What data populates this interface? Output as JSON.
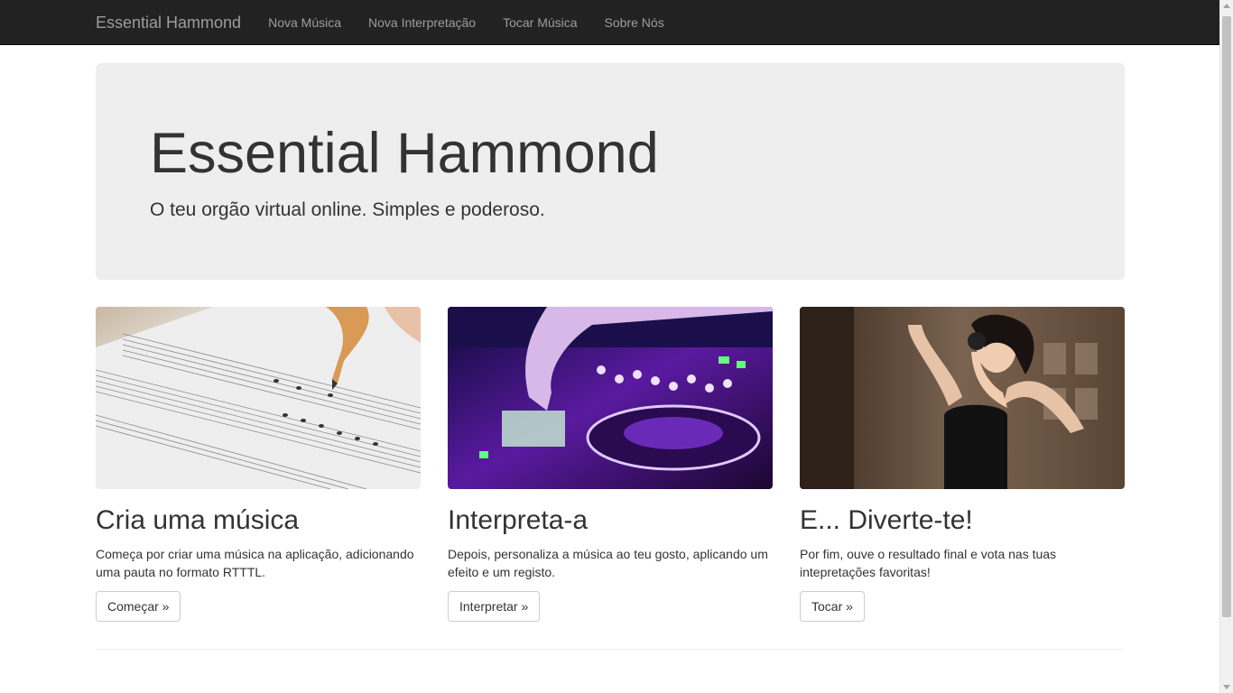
{
  "navbar": {
    "brand": "Essential Hammond",
    "links": [
      "Nova Música",
      "Nova Interpretação",
      "Tocar Música",
      "Sobre Nós"
    ]
  },
  "jumbotron": {
    "title": "Essential Hammond",
    "subtitle": "O teu orgão virtual online. Simples e poderoso."
  },
  "cards": [
    {
      "title": "Cria uma música",
      "text": "Começa por criar uma música na aplicação, adicionando uma pauta no formato RTTTL.",
      "button": "Começar »",
      "image": "sheet-music-photo"
    },
    {
      "title": "Interpreta-a",
      "text": "Depois, personaliza a música ao teu gosto, aplicando um efeito e um registo.",
      "button": "Interpretar »",
      "image": "dj-mixer-photo"
    },
    {
      "title": "E... Diverte-te!",
      "text": "Por fim, ouve o resultado final e vota nas tuas intepretações favoritas!",
      "button": "Tocar »",
      "image": "woman-headphones-photo"
    }
  ],
  "colors": {
    "navbar_bg": "#222222",
    "navbar_text": "#9d9d9d",
    "jumbotron_bg": "#eeeeee",
    "text": "#333333"
  }
}
